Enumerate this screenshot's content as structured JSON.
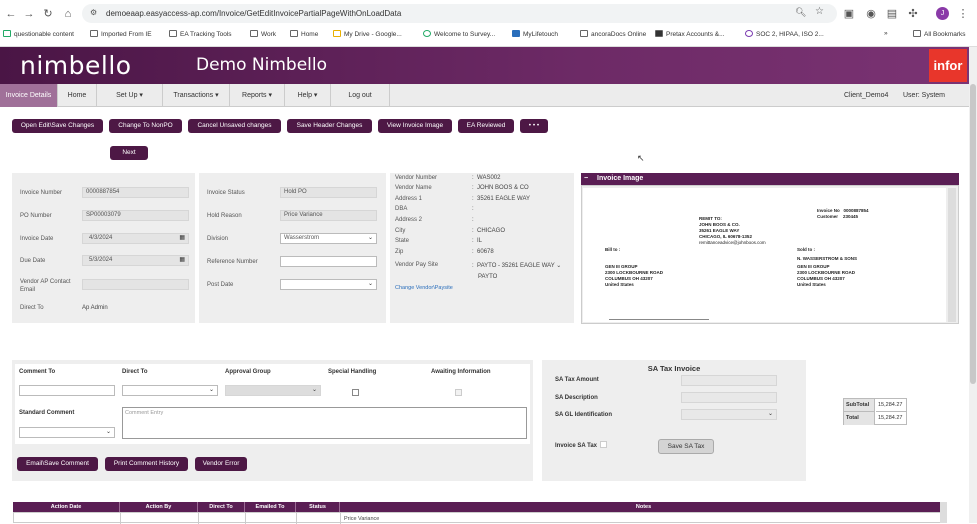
{
  "browser": {
    "url": "demoeaap.easyaccess-ap.com/Invoice/GetEditInvoicePartialPageWithOnLoadData",
    "bookmarks": [
      "questionable content",
      "Imported From IE",
      "EA Tracking Tools",
      "Work",
      "Home",
      "My Drive - Google...",
      "Welcome to Survey...",
      "MyLifetouch",
      "ancoraDocs Online",
      "Pretax Accounts &...",
      "SOC 2, HIPAA, ISO 2..."
    ],
    "all_bookmarks": "All Bookmarks",
    "profile_initial": "J"
  },
  "header": {
    "logo": "nimbello",
    "title": "Demo Nimbello",
    "brand": "infor"
  },
  "menu": {
    "items": [
      "Invoice Details",
      "Home",
      "Set Up ▾",
      "Transactions ▾",
      "Reports ▾",
      "Help ▾",
      "Log out"
    ],
    "client": "Client_Demo4",
    "user": "User: System"
  },
  "actions": [
    "Open Edit\\Save Changes",
    "Change To NonPO",
    "Cancel Unsaved changes",
    "Save Header Changes",
    "View Invoice Image",
    "EA Reviewed",
    "• • •"
  ],
  "next": "Next",
  "invoice": {
    "number_label": "Invoice Number",
    "number": "0000887854",
    "po_label": "PO Number",
    "po": "SP00003079",
    "date_label": "Invoice Date",
    "date": "4/3/2024",
    "due_label": "Due Date",
    "due": "5/3/2024",
    "contact_label": "Vendor AP Contact Email",
    "contact": "",
    "direct_label": "Direct To",
    "direct": "Ap Admin",
    "status_label": "Invoice Status",
    "status": "Hold PO",
    "hold_label": "Hold Reason",
    "hold": "Price Variance",
    "division_label": "Division",
    "division": "Wasserstrom",
    "ref_label": "Reference Number",
    "ref": "",
    "post_label": "Post Date",
    "post": ""
  },
  "vendor": {
    "rows": [
      [
        "Vendor Number",
        "WAS002"
      ],
      [
        "Vendor Name",
        "JOHN BOOS & CO"
      ],
      [
        "Address 1",
        "35261 EAGLE WAY"
      ],
      [
        "DBA",
        ""
      ],
      [
        "Address 2",
        ""
      ],
      [
        "City",
        "CHICAGO"
      ],
      [
        "State",
        "IL"
      ],
      [
        "Zip",
        "60678"
      ]
    ],
    "paysite_label": "Vendor Pay Site",
    "paysite": "PAYTO - 35261 EAGLE WAY",
    "payto": "PAYTO",
    "change_link": "Change Vendor\\Paysite"
  },
  "image": {
    "header": "Invoice Image",
    "remit": [
      "REMIT TO:",
      "JOHN BOOS & CO.",
      "35261 EAGLE WAY",
      "CHICAGO, IL 60678-1352",
      "remittanceadvice@johnboos.com"
    ],
    "inv": [
      "Invoice No",
      "0000887854",
      "Customer",
      "230445"
    ],
    "billto": [
      "Bill to :",
      "GEN III GROUP",
      "2300 LOCKBOURNE ROAD",
      "COLUMBUS OH 43207",
      "United States"
    ],
    "soldto": [
      "Sold to :",
      "N. WASSERSTROM & SONS",
      "GEN III GROUP",
      "2300 LOCKBOURNE ROAD",
      "COLUMBUS OH 43207",
      "United States"
    ]
  },
  "comment": {
    "comment_to": "Comment To",
    "direct_to": "Direct To",
    "approval": "Approval Group",
    "special": "Special Handling",
    "awaiting": "Awaiting Information",
    "standard": "Standard Comment",
    "entry_placeholder": "Comment Entry",
    "buttons": [
      "Email\\Save Comment",
      "Print Comment History",
      "Vendor Error"
    ]
  },
  "satax": {
    "title": "SA Tax Invoice",
    "amount": "SA Tax Amount",
    "description": "SA Description",
    "gl": "SA GL Identification",
    "invoice_tax": "Invoice SA Tax",
    "save": "Save SA Tax"
  },
  "totals": {
    "subtotal_label": "SubTotal",
    "subtotal": "15,284.27",
    "total_label": "Total",
    "total": "15,284.27"
  },
  "table": {
    "headers": [
      "Action Date",
      "Action By",
      "Direct To",
      "Emailed To",
      "Status",
      "Notes"
    ],
    "first_note": "Price Variance"
  },
  "colors": {
    "brand": "#4d1845",
    "header_grad": "#6d2a66",
    "infor": "#e8362b"
  }
}
